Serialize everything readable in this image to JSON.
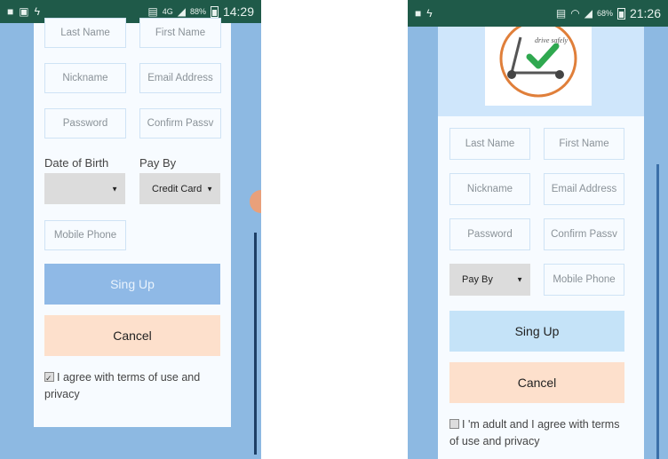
{
  "left": {
    "status_time": "14:29",
    "status_network": "4G",
    "status_battery": "88%",
    "fields": {
      "last_name": "Last Name",
      "first_name": "First Name",
      "nickname": "Nickname",
      "email": "Email Address",
      "password": "Password",
      "confirm_password": "Confirm Passv",
      "mobile_phone": "Mobile Phone"
    },
    "date_of_birth_label": "Date of Birth",
    "pay_by_label": "Pay By",
    "date_of_birth_value": "",
    "pay_by_value": "Credit Card",
    "signup_label": "Sing Up",
    "cancel_label": "Cancel",
    "terms_text": "I agree with terms of use and privacy"
  },
  "right": {
    "status_time": "21:26",
    "status_battery": "68%",
    "logo_text": "drive safely",
    "fields": {
      "last_name": "Last Name",
      "first_name": "First Name",
      "nickname": "Nickname",
      "email": "Email Address",
      "password": "Password",
      "confirm_password": "Confirm Passv",
      "mobile_phone": "Mobile Phone"
    },
    "pay_by_value": "Pay By",
    "signup_label": "Sing Up",
    "cancel_label": "Cancel",
    "terms_text": "I 'm adult and I agree with terms of use and privacy"
  },
  "colors": {
    "status_bar": "#1f5a49",
    "page_blue": "#8db9e2",
    "card": "#f7fbff",
    "signup_left": "#8fb9e6",
    "signup_right": "#c5e3f8",
    "cancel": "#fde0cc"
  }
}
